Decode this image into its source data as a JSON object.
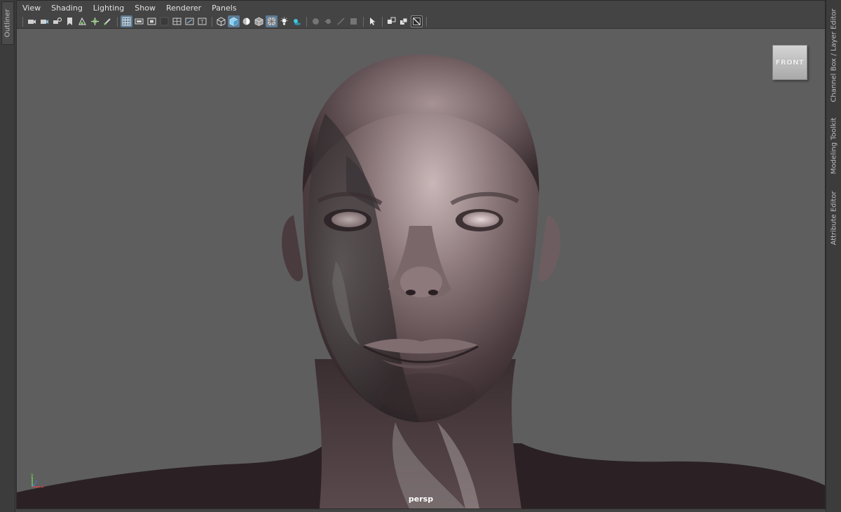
{
  "left_tabs": [
    {
      "label": "Outliner"
    }
  ],
  "right_tabs": [
    {
      "label": "Channel Box / Layer Editor"
    },
    {
      "label": "Modeling Toolkit"
    },
    {
      "label": "Attribute Editor"
    }
  ],
  "menubar": {
    "items": [
      {
        "label": "View"
      },
      {
        "label": "Shading"
      },
      {
        "label": "Lighting"
      },
      {
        "label": "Show"
      },
      {
        "label": "Renderer"
      },
      {
        "label": "Panels"
      }
    ]
  },
  "toolbar": {
    "groups": [
      [
        "camera-select-icon",
        "camera-attributes-icon",
        "camera-lock-icon",
        "bookmark-icon",
        "image-plane-icon",
        "two-d-pan-icon",
        "grease-pencil-icon"
      ],
      [
        "grid-icon",
        "film-gate-icon",
        "resolution-gate-icon",
        "gate-mask-icon",
        "field-chart-icon",
        "safe-action-icon",
        "safe-title-icon"
      ],
      [
        "wireframe-icon",
        "smooth-shade-icon",
        "default-material-icon",
        "wireframe-on-shaded-icon",
        "xray-icon",
        "use-all-lights-icon",
        "shadows-icon"
      ],
      [
        "screen-space-ao-icon",
        "motion-blur-icon",
        "multisample-aa-icon",
        "depth-of-field-icon"
      ],
      [
        "isolate-select-icon",
        "xray-active-icon",
        "xray-joints-icon",
        "backface-culling-icon"
      ]
    ],
    "active": [
      "grid-icon",
      "smooth-shade-icon",
      "xray-icon"
    ]
  },
  "viewport": {
    "view_cube_label": "FRONT",
    "camera_label": "persp",
    "background_color": "#5e5e5f",
    "axis_colors": {
      "x": "#e8413c",
      "y": "#6fdc4c",
      "z": "#3f7fe6"
    }
  },
  "colors": {
    "panel_bg": "#444444",
    "accent": "#5d7c97",
    "skin": "#6a5a5c"
  }
}
